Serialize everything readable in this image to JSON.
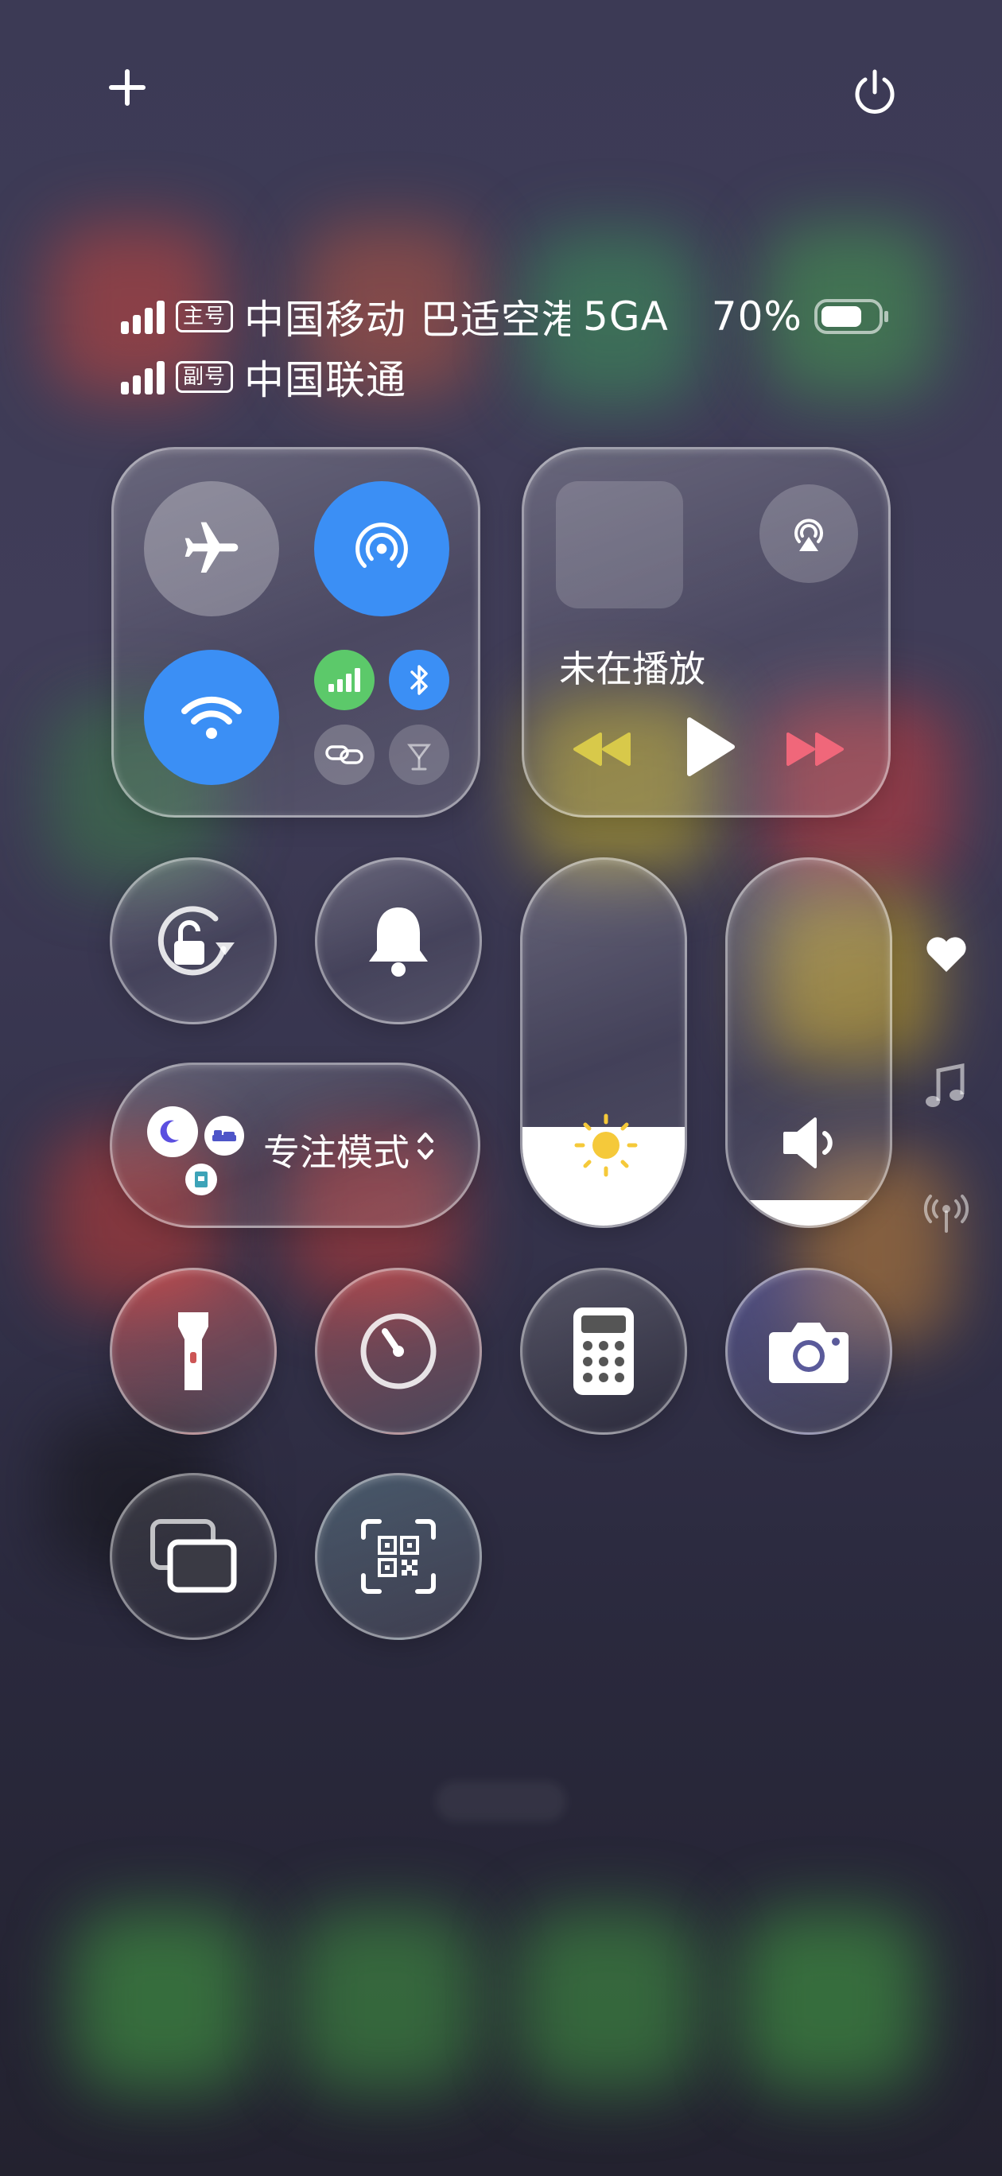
{
  "status": {
    "sim1": {
      "badge": "主号",
      "carrier": "中国移动 巴适空港",
      "network": "5GA"
    },
    "sim2": {
      "badge": "副号",
      "carrier": "中国联通"
    },
    "battery": "70%"
  },
  "connectivity": {
    "airplane_mode": false,
    "hotspot": true,
    "wifi": true,
    "mobile_data": true,
    "bluetooth": true
  },
  "media": {
    "now_playing": "未在播放"
  },
  "focus": {
    "label": "专注模式"
  },
  "sliders": {
    "brightness": 0.27,
    "volume": 0.07
  },
  "icons": {
    "top": [
      "plus-icon",
      "power-icon"
    ],
    "side": [
      "heart-icon",
      "music-note-icon",
      "antenna-icon"
    ]
  },
  "colors": {
    "accent_blue": "#3b8ff5",
    "mobile_data_green": "#5cc96a",
    "brightness_yellow": "#f5c93a"
  }
}
